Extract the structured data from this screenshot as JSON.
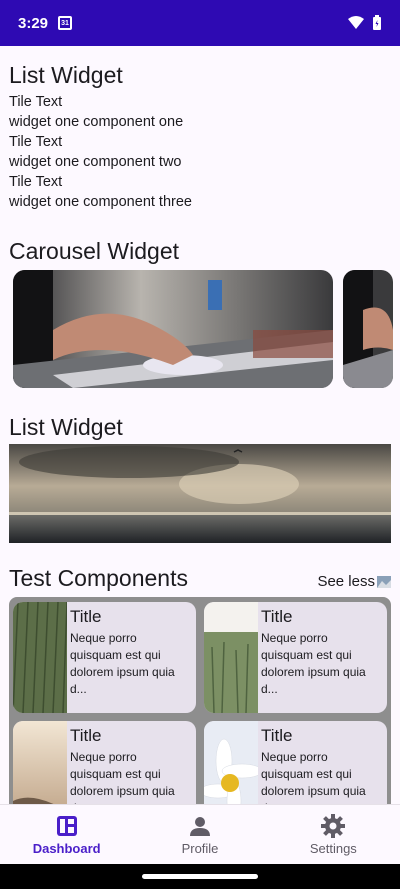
{
  "status": {
    "time": "3:29",
    "calendar_day": "31"
  },
  "list_widget_1": {
    "title": "List Widget",
    "items": [
      {
        "title": "Tile Text",
        "subtitle": "widget one component one"
      },
      {
        "title": "Tile Text",
        "subtitle": "widget one component two"
      },
      {
        "title": "Tile Text",
        "subtitle": "widget one component three"
      }
    ]
  },
  "carousel": {
    "title": "Carousel Widget"
  },
  "list_widget_2": {
    "title": "List Widget"
  },
  "test_components": {
    "title": "Test Components",
    "see_less": "See less",
    "cards": [
      {
        "title": "Title",
        "desc": "Neque porro quisquam est qui dolorem ipsum quia d..."
      },
      {
        "title": "Title",
        "desc": "Neque porro quisquam est qui dolorem ipsum quia d..."
      },
      {
        "title": "Title",
        "desc": "Neque porro quisquam est qui dolorem ipsum quia d..."
      },
      {
        "title": "Title",
        "desc": "Neque porro quisquam est qui dolorem ipsum quia d..."
      }
    ]
  },
  "bottom_nav": {
    "items": [
      {
        "label": "Dashboard",
        "icon": "dashboard-icon",
        "active": true
      },
      {
        "label": "Profile",
        "icon": "person-icon",
        "active": false
      },
      {
        "label": "Settings",
        "icon": "gear-icon",
        "active": false
      }
    ]
  },
  "colors": {
    "status_bar": "#2e0ab3",
    "accent": "#4a1fc9",
    "card_bg": "#e7e1ec"
  }
}
